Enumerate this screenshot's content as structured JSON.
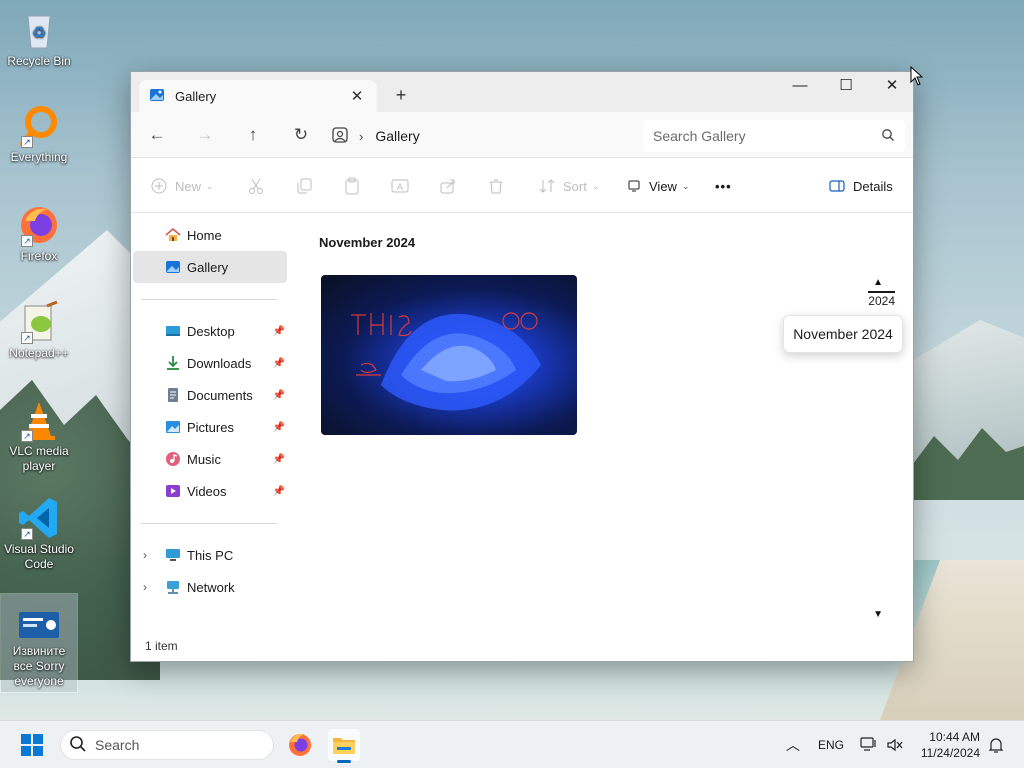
{
  "desktop": {
    "icons": [
      {
        "label": "Recycle Bin"
      },
      {
        "label": "Everything"
      },
      {
        "label": "Firefox"
      },
      {
        "label": "Notepad++"
      },
      {
        "label": "VLC media player"
      },
      {
        "label": "Visual Studio Code"
      },
      {
        "label": "Извините все Sorry everyone"
      }
    ]
  },
  "window": {
    "tab_title": "Gallery",
    "tab_close": "✕",
    "new_tab": "+",
    "controls": {
      "minimize": "—",
      "maximize": "☐",
      "close": "✕"
    },
    "nav": {
      "back": "←",
      "forward": "→",
      "up": "↑",
      "refresh": "↻"
    },
    "address": {
      "crumb": "Gallery",
      "separator": "›"
    },
    "search": {
      "placeholder": "Search Gallery"
    },
    "commands": {
      "new": "New",
      "sort": "Sort",
      "view": "View",
      "more": "•••",
      "details": "Details"
    },
    "sidebar": {
      "quick": [
        {
          "label": "Home"
        },
        {
          "label": "Gallery"
        }
      ],
      "pinned": [
        {
          "label": "Desktop"
        },
        {
          "label": "Downloads"
        },
        {
          "label": "Documents"
        },
        {
          "label": "Pictures"
        },
        {
          "label": "Music"
        },
        {
          "label": "Videos"
        }
      ],
      "locations": [
        {
          "label": "This PC"
        },
        {
          "label": "Network"
        }
      ],
      "active": "Gallery"
    },
    "content": {
      "group_title": "November 2024",
      "timeline_year": "2024",
      "timeline_tooltip": "November 2024"
    },
    "status": "1 item"
  },
  "taskbar": {
    "search_label": "Search",
    "language": "ENG",
    "time": "10:44 AM",
    "date": "11/24/2024"
  }
}
